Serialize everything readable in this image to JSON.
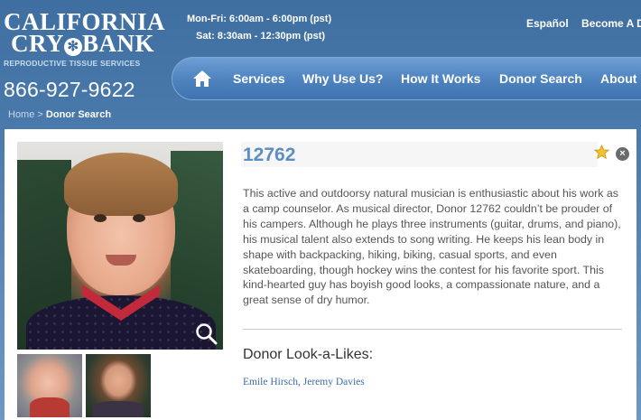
{
  "logo": {
    "line1": "CALIFORNIA",
    "line2a": "CRY",
    "line2b": "BANK",
    "tagline": "REPRODUCTIVE TISSUE SERVICES"
  },
  "phone": "866-927-9622",
  "hours": {
    "weekday": "Mon-Fri: 6:00am - 6:00pm (pst)",
    "saturday": "Sat: 8:30am - 12:30pm (pst)"
  },
  "toplinks": [
    "Español",
    "Become A D"
  ],
  "nav": {
    "home_icon": "home-icon",
    "items": [
      "Services",
      "Why Use Us?",
      "How It Works",
      "Donor Search",
      "About U"
    ]
  },
  "breadcrumb": {
    "home": "Home",
    "separator": ">",
    "current": "Donor Search"
  },
  "donor": {
    "id": "12762",
    "bio": "This active and outdoorsy natural musician is enthusiastic about his work as a camp counselor. As musical director, Donor 12762 couldn’t be prouder of his campers. Although he plays three instruments (guitar, drums, and piano), his musical talent also extends to song writing. He keeps his lean body in shape with backpacking, hiking, biking, casual sports, and even skateboarding, though hockey wins the contest for his favorite sport. This kind-hearted guy has boyish good looks, a compassionate nature, and a great sense of dry humor.",
    "lookalikes_title": "Donor Look-a-Likes:",
    "lookalikes": "Emile Hirsch, Jeremy Davies"
  },
  "colors": {
    "header_blue": "#3f6ea1",
    "nav_blue": "#4f84c0",
    "donor_id_blue": "#5b8ec2",
    "link_blue": "#3a6ea8"
  }
}
